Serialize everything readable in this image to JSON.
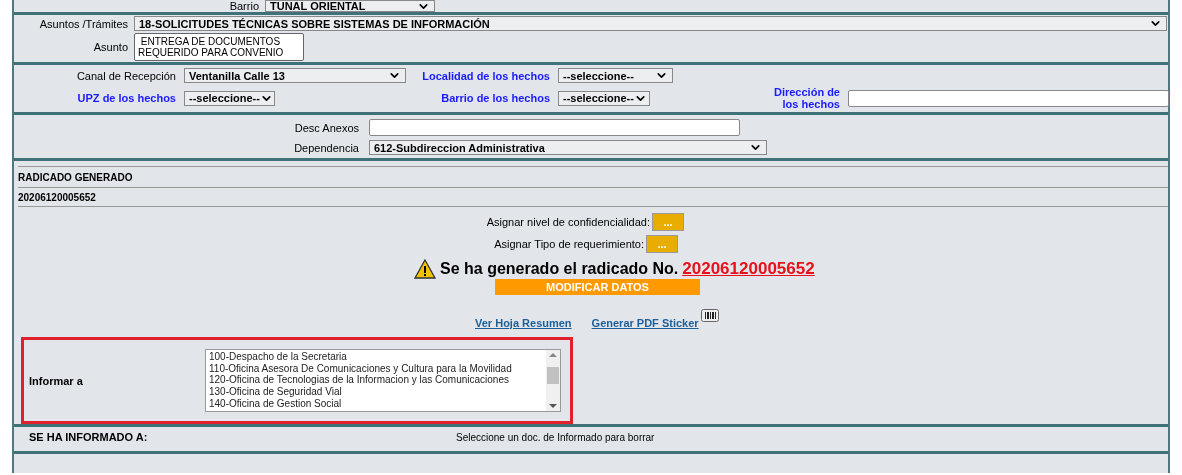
{
  "barrio_top": {
    "label": "Barrio",
    "value": "TUNAL ORIENTAL"
  },
  "asuntos": {
    "label": "Asuntos /Trámites",
    "value": "18-SOLICITUDES TÉCNICAS SOBRE SISTEMAS DE INFORMACIÓN"
  },
  "asunto": {
    "label": "Asunto",
    "value": " ENTREGA DE DOCUMENTOS\nREQUERIDO PARA CONVENIO"
  },
  "canal": {
    "label": "Canal de Recepción",
    "value": "Ventanilla Calle 13"
  },
  "localidad": {
    "label": "Localidad de los hechos",
    "value": "--seleccione--"
  },
  "upz": {
    "label": "UPZ de los hechos",
    "value": "--seleccione--"
  },
  "barrio": {
    "label": "Barrio de los hechos",
    "value": "--seleccione--"
  },
  "direccion": {
    "label": "Dirección de los hechos"
  },
  "desc_anexos": {
    "label": "Desc Anexos"
  },
  "dependencia": {
    "label": "Dependencia",
    "value": "612-Subdireccion Administrativa"
  },
  "radicado_header": "RADICADO GENERADO",
  "radicado_value": "20206120005652",
  "asignar": [
    {
      "label": "Asignar nivel de confidencialidad:",
      "button": "..."
    },
    {
      "label": "Asignar Tipo de requerimiento:",
      "button": "..."
    }
  ],
  "message": {
    "text": "Se ha generado el radicado No.",
    "number": "20206120005652"
  },
  "modify_button": "MODIFICAR DATOS",
  "links": [
    {
      "label": "Ver Hoja Resumen",
      "icon": false
    },
    {
      "label": "Generar PDF Sticker",
      "icon": true
    }
  ],
  "informar": {
    "label": "Informar a",
    "options": [
      "100-Despacho de la Secretaria",
      "110-Oficina Asesora De Comunicaciones y Cultura para la Movilidad",
      "120-Oficina de Tecnologias de la Informacion y las Comunicaciones",
      "130-Oficina de Seguridad Vial",
      "140-Oficina de Gestion Social"
    ]
  },
  "informado": {
    "label": "SE HA INFORMADO A:",
    "hint": "Seleccione un doc. de Informado para borrar"
  }
}
